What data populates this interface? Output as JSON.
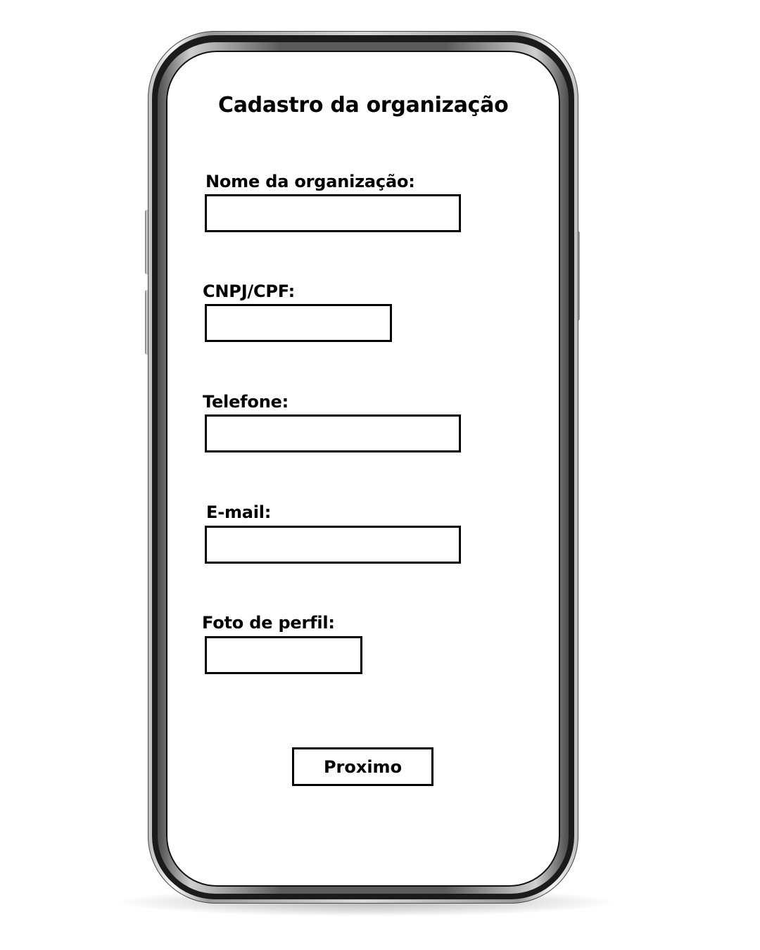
{
  "form": {
    "title": "Cadastro da organização",
    "fields": [
      {
        "label": "Nome da organização:",
        "value": ""
      },
      {
        "label": "CNPJ/CPF:",
        "value": ""
      },
      {
        "label": "Telefone:",
        "value": ""
      },
      {
        "label": "E-mail:",
        "value": ""
      },
      {
        "label": "Foto de perfil:",
        "value": ""
      }
    ],
    "next_label": "Proximo"
  }
}
